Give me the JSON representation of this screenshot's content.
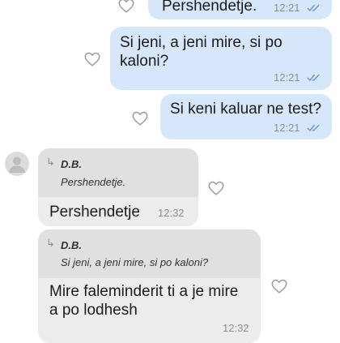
{
  "messages": [
    {
      "text": "Pershendetje.",
      "time": "12:21"
    },
    {
      "line1": "Si jeni, a jeni mire, si po",
      "line2": "kaloni?",
      "time": "12:21"
    },
    {
      "text": "Si keni kaluar ne test?",
      "time": "12:21"
    },
    {
      "quote_author": "D.B.",
      "quote_text": "Pershendetje.",
      "text": "Pershendetje",
      "time": "12:32"
    },
    {
      "quote_author": "D.B.",
      "quote_text": "Si jeni, a jeni mire, si po kaloni?",
      "line1": "Mire faleminderit ti a je mire",
      "line2": "a po lodhesh",
      "time": "12:32"
    }
  ],
  "icons": {
    "like": "heart-outline-icon",
    "read": "double-check-icon",
    "reply": "reply-arrow-icon",
    "avatar": "user-avatar-icon"
  },
  "colors": {
    "outgoing_bubble": "#d6e7fb",
    "incoming_bubble": "#ececec",
    "read_ticks": "#6c8fd6"
  }
}
